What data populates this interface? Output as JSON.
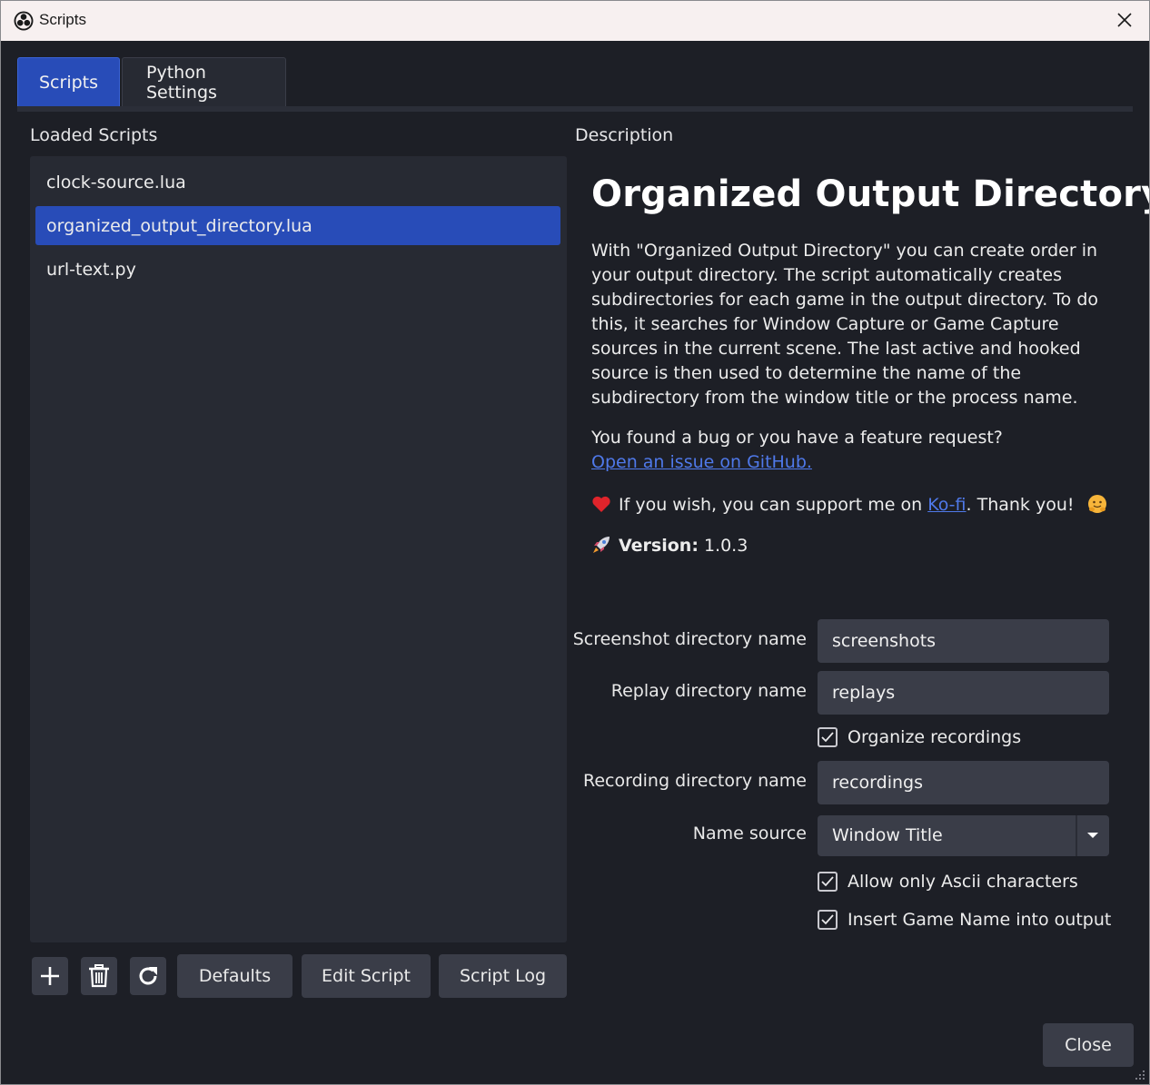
{
  "window": {
    "title": "Scripts",
    "close_icon": "close-icon"
  },
  "tabs": [
    {
      "label": "Scripts",
      "active": true
    },
    {
      "label": "Python Settings",
      "active": false
    }
  ],
  "loaded_scripts": {
    "label": "Loaded Scripts",
    "items": [
      {
        "name": "clock-source.lua",
        "selected": false
      },
      {
        "name": "organized_output_directory.lua",
        "selected": true
      },
      {
        "name": "url-text.py",
        "selected": false
      }
    ]
  },
  "toolbar": {
    "add_icon": "plus-icon",
    "remove_icon": "trash-icon",
    "reload_icon": "refresh-icon",
    "defaults_label": "Defaults",
    "edit_label": "Edit Script",
    "log_label": "Script Log"
  },
  "description": {
    "label": "Description",
    "title": "Organized Output Directory",
    "paragraph": "With \"Organized Output Directory\" you can create order in your output directory. The script automatically creates subdirectories for each game in the output directory. To do this, it searches for Window Capture or Game Capture sources in the current scene. The last active and hooked source is then used to determine the name of the subdirectory from the window title or the process name.",
    "bug_text": "You found a bug or you have a feature request?",
    "github_link": "Open an issue on GitHub.",
    "support_prefix": "If you wish, you can support me on ",
    "kofi_link": "Ko-fi",
    "support_suffix": ". Thank you!",
    "version_label": "Version:",
    "version_value": "1.0.3"
  },
  "settings": {
    "screenshot_label": "Screenshot directory name",
    "screenshot_value": "screenshots",
    "replay_label": "Replay directory name",
    "replay_value": "replays",
    "organize_recordings_label": "Organize recordings",
    "organize_recordings_checked": true,
    "recording_label": "Recording directory name",
    "recording_value": "recordings",
    "name_source_label": "Name source",
    "name_source_value": "Window Title",
    "ascii_label": "Allow only Ascii characters",
    "ascii_checked": true,
    "insert_game_label": "Insert Game Name into output",
    "insert_game_checked": true
  },
  "footer": {
    "close_label": "Close"
  },
  "colors": {
    "accent": "#284cb8",
    "background": "#1d1f26",
    "panel": "#272a33",
    "button": "#3a3d48",
    "link": "#4f79ea"
  }
}
